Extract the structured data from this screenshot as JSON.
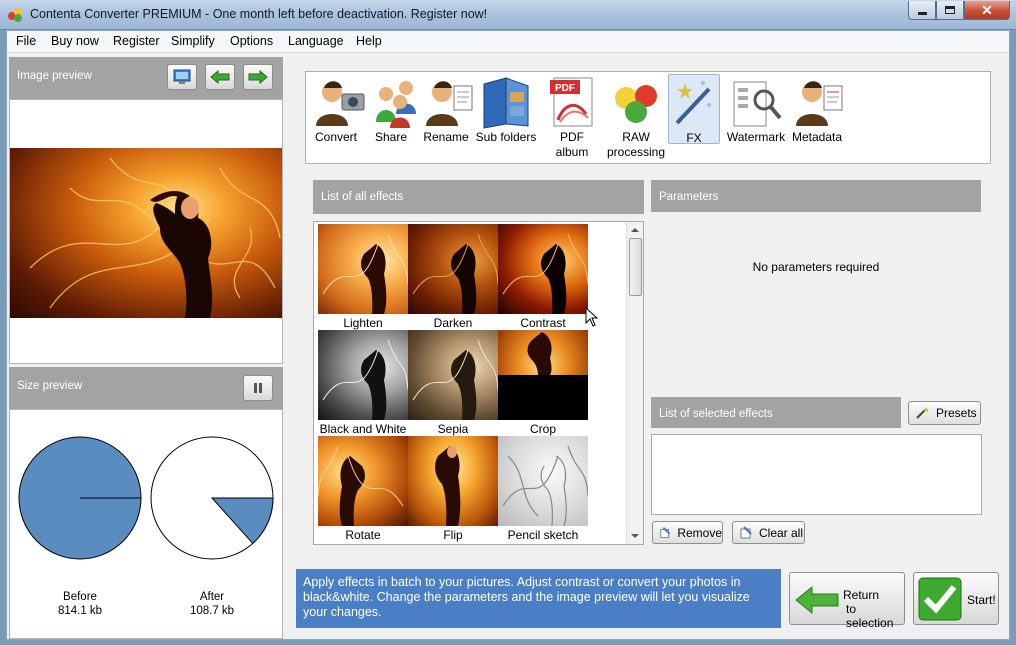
{
  "window": {
    "title": "Contenta Converter PREMIUM  - One month left before deactivation. Register now!",
    "min": "0",
    "max": "1",
    "close": "r"
  },
  "menu": [
    "File",
    "Buy now",
    "Register",
    "Simplify",
    "Options",
    "Language",
    "Help"
  ],
  "image_preview": {
    "label": "Image preview"
  },
  "size_preview": {
    "label": "Size preview",
    "before_label": "Before",
    "before_size": "814.1 kb",
    "after_label": "After",
    "after_size": "108.7 kb",
    "ratio": 0.1335
  },
  "toolbar": {
    "tools": [
      {
        "label": "Convert",
        "icon": "convert-icon"
      },
      {
        "label": "Share",
        "icon": "share-icon"
      },
      {
        "label": "Rename",
        "icon": "rename-icon"
      },
      {
        "label": "Sub folders",
        "icon": "subfolders-icon"
      },
      {
        "label": "PDF album",
        "icon": "pdf-icon"
      },
      {
        "label": "RAW processing",
        "icon": "raw-icon"
      },
      {
        "label": "FX",
        "icon": "fx-icon"
      },
      {
        "label": "Watermark",
        "icon": "watermark-icon"
      },
      {
        "label": "Metadata",
        "icon": "metadata-icon"
      }
    ],
    "active": "FX",
    "pdf_badge": "PDF"
  },
  "effects": {
    "label": "List of all effects",
    "items": [
      "Lighten",
      "Darken",
      "Contrast",
      "Black and White",
      "Sepia",
      "Crop",
      "Rotate",
      "Flip",
      "Pencil sketch"
    ]
  },
  "parameters": {
    "label": "Parameters",
    "text": "No parameters required"
  },
  "selected": {
    "label": "List of selected effects",
    "presets": "Presets",
    "remove": "Remove",
    "clear_all": "Clear all"
  },
  "info": "Apply effects in batch to your pictures. Adjust contrast or convert your photos in black&white. Change the parameters and the image preview will let you visualize your changes.",
  "actions": {
    "return_line1": "Return",
    "return_line2": "to selection",
    "start": "Start!"
  },
  "colors": {
    "accent": "#4a7fc6",
    "pie": "#5b8cc0",
    "panel_header": "#a3a3a3"
  }
}
